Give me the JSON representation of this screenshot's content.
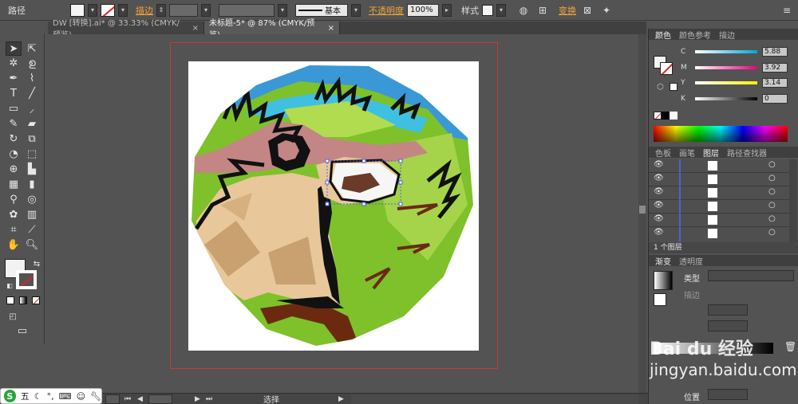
{
  "toolbar": {
    "path_label": "路径",
    "stroke_label": "描边",
    "stroke_style": "基本",
    "opacity_label": "不透明度",
    "opacity_value": "100%",
    "style_label": "样式",
    "transform_label": "变换"
  },
  "tabs": [
    {
      "label": "DW [转换].ai* @ 33.33% (CMYK/预览)",
      "close": "×"
    },
    {
      "label": "未标题-5* @ 87% (CMYK/预览)",
      "close": "×"
    }
  ],
  "color_panel": {
    "tabs": [
      "颜色",
      "颜色参考",
      "描边"
    ],
    "channels": [
      {
        "name": "C",
        "value": "5.88",
        "color": "#00a7d8"
      },
      {
        "name": "M",
        "value": "3.92",
        "color": "#e5007e"
      },
      {
        "name": "Y",
        "value": "3.14",
        "color": "#fff100"
      },
      {
        "name": "K",
        "value": "0",
        "color": "#000000"
      }
    ]
  },
  "layers_panel": {
    "tabs": [
      "色板",
      "画笔",
      "图层",
      "路径查找器"
    ],
    "footer": "1 个图层"
  },
  "gradient_panel": {
    "tabs": [
      "渐变",
      "透明度"
    ],
    "type_label": "类型",
    "stroke_label": "描边",
    "position_label": "位置"
  },
  "status": {
    "mode": "选择"
  },
  "ime": {
    "mode": "五"
  },
  "watermark": {
    "brand": "Bai du 经验",
    "url": "jingyan.baidu.com"
  },
  "art_colors": {
    "sky": "#3a98d6",
    "grass": "#7ec12a",
    "grass_light": "#a5d44a",
    "ear": "#c48585",
    "fur": "#e8c79b",
    "fur_dark": "#c9a070",
    "brown": "#6b2a10",
    "black": "#111111"
  }
}
